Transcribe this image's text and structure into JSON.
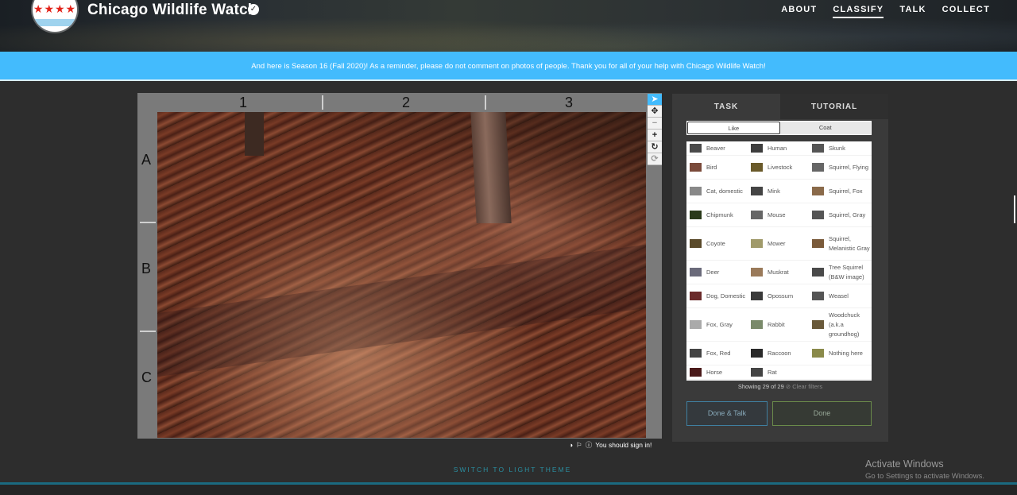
{
  "header": {
    "title": "Chicago Wildlife Watch",
    "logo_stars": "★★★★",
    "verified_icon": "✓",
    "nav": [
      "ABOUT",
      "CLASSIFY",
      "TALK",
      "COLLECT"
    ],
    "active_nav": "CLASSIFY"
  },
  "announcement": "And here is Season 16 (Fall 2020)! As a reminder, please do not comment on photos of people. Thank you for all of your help with Chicago Wildlife Watch!",
  "grid_labels": {
    "columns": [
      "1",
      "2",
      "3"
    ],
    "rows": [
      "A",
      "B",
      "C"
    ]
  },
  "tools": {
    "pointer": "➤",
    "move": "✥",
    "zoom_out": "−",
    "zoom_in": "+",
    "rotate": "↻",
    "reset": "⟳"
  },
  "image_footer": {
    "sign_in_text": "You should sign in!"
  },
  "panel": {
    "tabs": [
      "TASK",
      "TUTORIAL"
    ],
    "filters": [
      "Like",
      "Coat"
    ],
    "species": [
      "Beaver",
      "Human",
      "Skunk",
      "Bird",
      "Livestock",
      "Squirrel, Flying",
      "Cat, domestic",
      "Mink",
      "Squirrel, Fox",
      "Chipmunk",
      "Mouse",
      "Squirrel, Gray",
      "Coyote",
      "Mower",
      "Squirrel, Melanistic Gray",
      "Deer",
      "Muskrat",
      "Tree Squirrel (B&W image)",
      "Dog, Domestic",
      "Opossum",
      "Weasel",
      "Fox, Gray",
      "Rabbit",
      "Woodchuck (a.k.a groundhog)",
      "Fox, Red",
      "Raccoon",
      "Nothing here",
      "Horse",
      "Rat",
      ""
    ],
    "showing": "Showing 29 of 29",
    "clear_filters": "Clear filters",
    "done_talk": "Done & Talk",
    "done": "Done"
  },
  "switch_theme": "SWITCH TO LIGHT THEME",
  "watermark": {
    "line1": "Activate Windows",
    "line2": "Go to Settings to activate Windows."
  },
  "colors": {
    "accent_blue": "#43bbfd",
    "background": "#2d2d2d",
    "panel": "#3a3a3a"
  }
}
